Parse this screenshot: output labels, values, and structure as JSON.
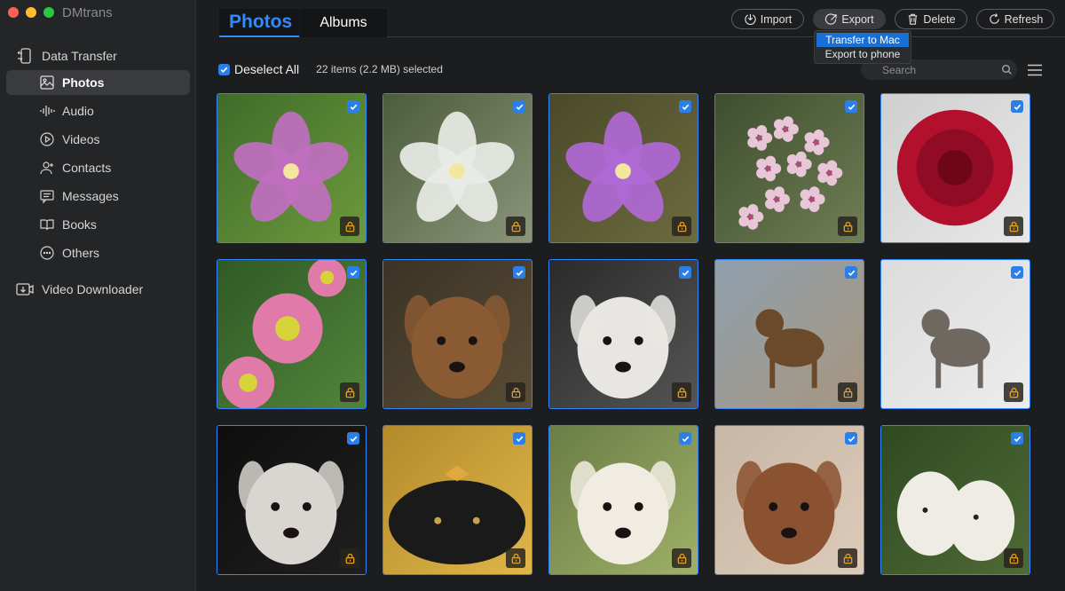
{
  "app": {
    "title": "DMtrans"
  },
  "window_controls": [
    "close",
    "minimize",
    "zoom"
  ],
  "sidebar": {
    "data_transfer": {
      "label": "Data Transfer",
      "icon": "phone-transfer-icon"
    },
    "items": [
      {
        "label": "Photos",
        "icon": "photo-icon",
        "active": true
      },
      {
        "label": "Audio",
        "icon": "audio-wave-icon"
      },
      {
        "label": "Videos",
        "icon": "play-circle-icon"
      },
      {
        "label": "Contacts",
        "icon": "person-icon"
      },
      {
        "label": "Messages",
        "icon": "message-icon"
      },
      {
        "label": "Books",
        "icon": "book-icon"
      },
      {
        "label": "Others",
        "icon": "more-circle-icon"
      }
    ],
    "video_downloader": {
      "label": "Video Downloader",
      "icon": "video-download-icon"
    }
  },
  "tabs": [
    {
      "label": "Photos",
      "active": true
    },
    {
      "label": "Albums",
      "active": false
    }
  ],
  "toolbar": {
    "import_label": "Import",
    "export_label": "Export",
    "delete_label": "Delete",
    "refresh_label": "Refresh"
  },
  "export_menu": {
    "items": [
      "Transfer to Mac",
      "Export to phone"
    ],
    "highlighted": "Transfer to Mac"
  },
  "selection": {
    "deselect_label": "Deselect All",
    "count_text": "22 items (2.2 MB) selected"
  },
  "search": {
    "placeholder": "Search"
  },
  "colors": {
    "accent": "#2f86ff",
    "checkbox": "#2b7fe8",
    "lock": "#e0a02a",
    "sidebar_bg": "#242527",
    "main_bg": "#1c1d1f"
  },
  "photos": [
    {
      "subject": "pink wildflower",
      "bg": [
        "#3f6b2a",
        "#6d9a3c"
      ],
      "fg": "#c06fc0",
      "kind": "flower"
    },
    {
      "subject": "white trillium",
      "bg": [
        "#4c5c3a",
        "#8a957a"
      ],
      "fg": "#e8ece6",
      "kind": "flower"
    },
    {
      "subject": "purple passionflower",
      "bg": [
        "#4a4a2a",
        "#6c6a3e"
      ],
      "fg": "#b069d6",
      "kind": "flower"
    },
    {
      "subject": "pink phlox cluster",
      "bg": [
        "#3e4e2e",
        "#6f7e55"
      ],
      "fg": "#e8c6d8",
      "kind": "cluster"
    },
    {
      "subject": "red dahlia",
      "bg": [
        "#cfcfcf",
        "#e8e8e8"
      ],
      "fg": "#b3102e",
      "kind": "round"
    },
    {
      "subject": "pink daisies",
      "bg": [
        "#2f5a26",
        "#53833a"
      ],
      "fg": "#e07aa8",
      "kind": "daisy"
    },
    {
      "subject": "spaniel puppy",
      "bg": [
        "#3b3326",
        "#5a4c36"
      ],
      "fg": "#8a5a32",
      "kind": "dog"
    },
    {
      "subject": "white puppies",
      "bg": [
        "#2a2a2a",
        "#555555"
      ],
      "fg": "#e8e6e2",
      "kind": "dog"
    },
    {
      "subject": "dog on beach",
      "bg": [
        "#8fa0ad",
        "#a79680"
      ],
      "fg": "#6b4a2c",
      "kind": "dog-small"
    },
    {
      "subject": "grey dog",
      "bg": [
        "#dcdcdc",
        "#ececec"
      ],
      "fg": "#6e6860",
      "kind": "dog-small"
    },
    {
      "subject": "husky",
      "bg": [
        "#0e0e0e",
        "#1f1f1f"
      ],
      "fg": "#d9d5d0",
      "kind": "dog"
    },
    {
      "subject": "black dog with leaf",
      "bg": [
        "#b38a2a",
        "#e0b64a"
      ],
      "fg": "#1a1a1a",
      "kind": "dog-low"
    },
    {
      "subject": "white spitz",
      "bg": [
        "#6a7d45",
        "#9fb069"
      ],
      "fg": "#f1ece2",
      "kind": "dog"
    },
    {
      "subject": "curly puppy",
      "bg": [
        "#c9b7a6",
        "#dccbb9"
      ],
      "fg": "#8a5230",
      "kind": "dog"
    },
    {
      "subject": "two white dogs",
      "bg": [
        "#2f4a22",
        "#4f6a35"
      ],
      "fg": "#efece6",
      "kind": "dogs"
    }
  ]
}
